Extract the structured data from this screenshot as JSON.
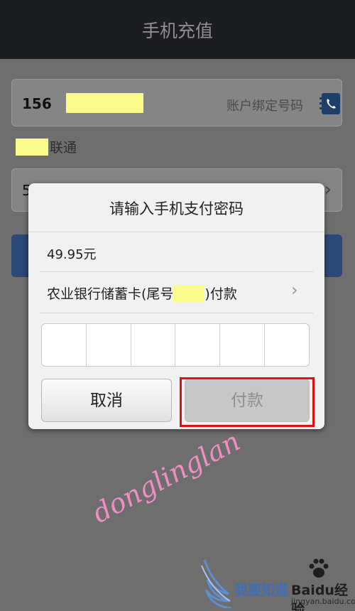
{
  "title": "手机充值",
  "phone": {
    "number": "156",
    "hint": "账户绑定号码"
  },
  "carrier": "联通",
  "amount_row": {
    "value": "5"
  },
  "dialog": {
    "title": "请输入手机支付密码",
    "amount": "49.95元",
    "card_prefix": "农业银行储蓄卡(尾号",
    "card_suffix": ")付款",
    "cancel_label": "取消",
    "pay_label": "付款",
    "pin_cells": 6
  },
  "watermark": "donglinglan",
  "logo": {
    "text_zh": "我要知道",
    "brand": "Baidu经验",
    "url": "jingyan.baidu.com"
  },
  "colors": {
    "mask": "#fbfb8c",
    "highlight": "#e01010",
    "watermark": "#f08ec3"
  }
}
